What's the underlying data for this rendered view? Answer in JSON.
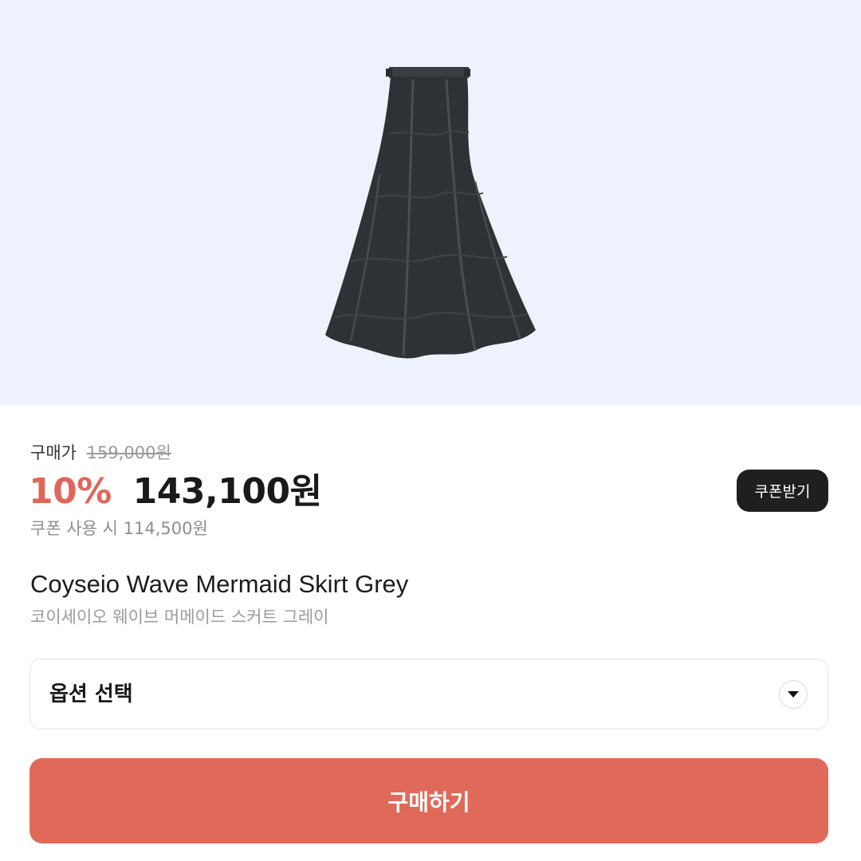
{
  "product": {
    "image_alt": "grey mermaid skirt",
    "price_label": "구매가",
    "original_price": "159,000원",
    "discount": "10%",
    "sale_price": "143,100원",
    "coupon_note": "쿠폰 사용 시 114,500원",
    "coupon_button": "쿠폰받기",
    "name_en": "Coyseio Wave Mermaid Skirt Grey",
    "name_ko": "코이세이오 웨이브 머메이드 스커트 그레이"
  },
  "options": {
    "placeholder": "옵션 선택",
    "icon": "chevron-down-icon"
  },
  "actions": {
    "buy_label": "구매하기"
  },
  "colors": {
    "hero_background": "#edf2fc",
    "accent": "#e06a5a",
    "coupon_button": "#1f1f1f"
  }
}
